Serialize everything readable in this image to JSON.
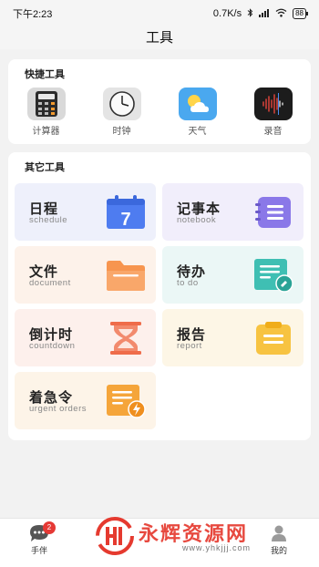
{
  "status_bar": {
    "time": "下午2:23",
    "network_speed": "0.7K/s",
    "battery": "88"
  },
  "header": {
    "title": "工具"
  },
  "quick_tools": {
    "title": "快捷工具",
    "items": [
      {
        "label": "计算器",
        "icon": "calculator-icon"
      },
      {
        "label": "时钟",
        "icon": "clock-icon"
      },
      {
        "label": "天气",
        "icon": "weather-icon"
      },
      {
        "label": "录音",
        "icon": "recorder-icon"
      }
    ]
  },
  "other_tools": {
    "title": "其它工具",
    "tiles": [
      {
        "title": "日程",
        "subtitle": "schedule",
        "icon": "calendar-icon",
        "bg": "#eef0fb",
        "accent": "#4e7cf0",
        "icon_text": "7"
      },
      {
        "title": "记事本",
        "subtitle": "notebook",
        "icon": "notebook-icon",
        "bg": "#f1eefb",
        "accent": "#8a78e8"
      },
      {
        "title": "文件",
        "subtitle": "document",
        "icon": "folder-icon",
        "bg": "#fdf2ea",
        "accent": "#f7954f"
      },
      {
        "title": "待办",
        "subtitle": "to do",
        "icon": "todo-icon",
        "bg": "#ebf7f6",
        "accent": "#3fbfb3"
      },
      {
        "title": "倒计时",
        "subtitle": "countdown",
        "icon": "hourglass-icon",
        "bg": "#fdf0ec",
        "accent": "#ef6c4a"
      },
      {
        "title": "报告",
        "subtitle": "report",
        "icon": "clipboard-icon",
        "bg": "#fdf6e6",
        "accent": "#f7c341"
      },
      {
        "title": "着急令",
        "subtitle": "urgent orders",
        "icon": "urgent-icon",
        "bg": "#fdf4e8",
        "accent": "#f5a53a"
      }
    ]
  },
  "bottom_nav": {
    "items": [
      {
        "label": "手伴",
        "icon": "chat-icon",
        "badge": "2"
      },
      {
        "label": "我的",
        "icon": "profile-icon"
      }
    ]
  },
  "watermark": {
    "text": "永辉资源网",
    "url": "www.yhkjjj.com"
  }
}
